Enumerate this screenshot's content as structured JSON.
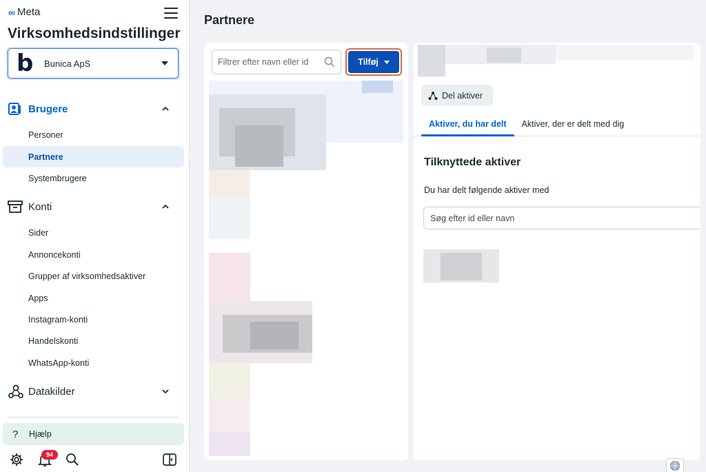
{
  "brand": {
    "meta_label": "Meta"
  },
  "app_title": "Virksomhedsindstillinger",
  "business": {
    "logo_letter": "b",
    "name": "Bunica ApS"
  },
  "sidebar": {
    "sections": [
      {
        "key": "brugere",
        "label": "Brugere",
        "icon": "users-icon",
        "expanded": true,
        "active": true,
        "items": [
          {
            "label": "Personer",
            "selected": false
          },
          {
            "label": "Partnere",
            "selected": true
          },
          {
            "label": "Systembrugere",
            "selected": false
          }
        ]
      },
      {
        "key": "konti",
        "label": "Konti",
        "icon": "archive-icon",
        "expanded": true,
        "active": false,
        "items": [
          {
            "label": "Sider"
          },
          {
            "label": "Annoncekonti"
          },
          {
            "label": "Grupper af virksomhedsaktiver"
          },
          {
            "label": "Apps"
          },
          {
            "label": "Instagram-konti"
          },
          {
            "label": "Handelskonti"
          },
          {
            "label": "WhatsApp-konti"
          }
        ]
      },
      {
        "key": "datakilder",
        "label": "Datakilder",
        "icon": "data-sources-icon",
        "expanded": false,
        "active": false
      }
    ],
    "help_label": "Hjælp",
    "notifications_count": "94"
  },
  "main": {
    "title": "Partnere",
    "filter_placeholder": "Filtrer efter navn eller id",
    "add_button_label": "Tilføj",
    "share_assets_label": "Del aktiver",
    "tabs": [
      {
        "label": "Aktiver, du har delt",
        "active": true
      },
      {
        "label": "Aktiver, der er delt med dig",
        "active": false
      }
    ],
    "assets_title": "Tilknyttede aktiver",
    "assets_subtitle": "Du har delt følgende aktiver med",
    "assets_search_placeholder": "Søg efter id eller navn"
  },
  "colors": {
    "accent": "#0064e0",
    "primary_button": "#0a4fb4",
    "badge": "#e41e3f",
    "selected_bg": "#e7effb",
    "help_bg": "#e3f2ec"
  }
}
